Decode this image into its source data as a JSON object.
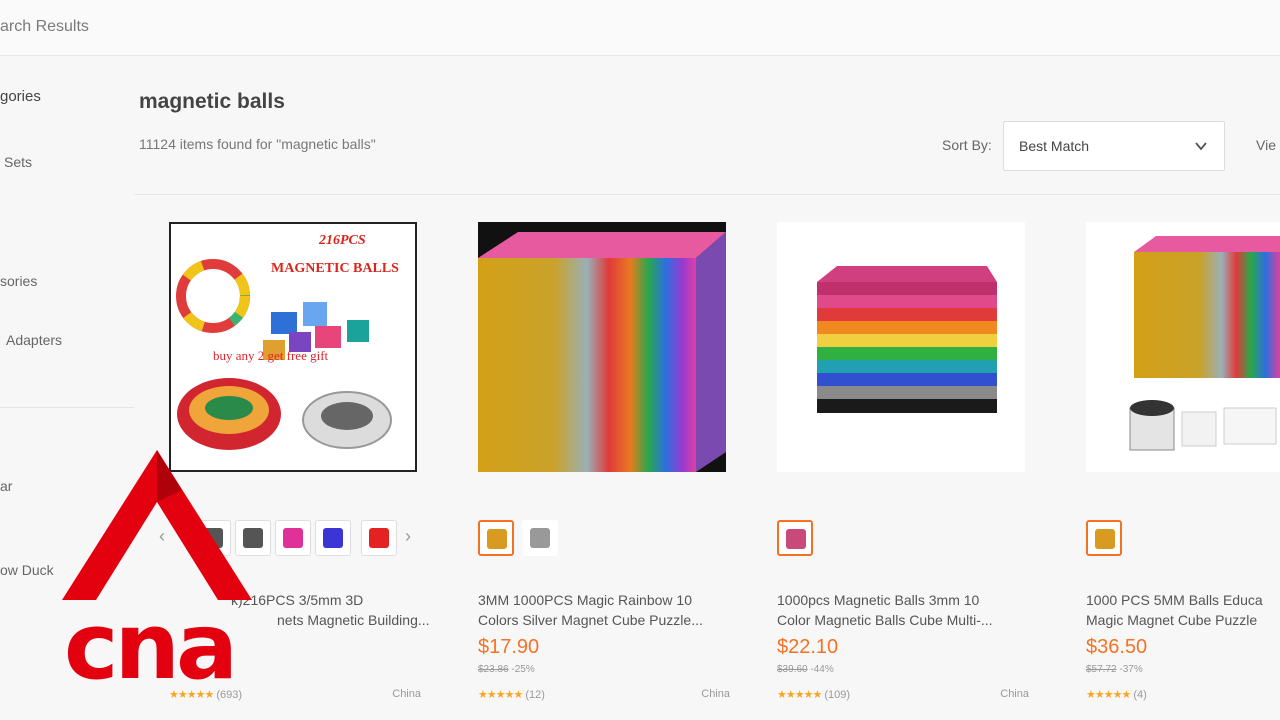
{
  "header": {
    "breadcrumb": "arch Results"
  },
  "sidebar": {
    "categories_heading": "gories",
    "items": [
      "Sets",
      "sories",
      "Adapters",
      "ar",
      "ow Duck"
    ]
  },
  "search": {
    "title": "magnetic balls",
    "count_text": "11124 items found for \"magnetic balls\""
  },
  "sort": {
    "label": "Sort By:",
    "value": "Best Match",
    "view_label": "Vie"
  },
  "products": [
    {
      "name_line1": "k)216PCS 3/5mm 3D",
      "name_line2": "nets Magnetic Building...",
      "price": "",
      "original_price": "",
      "discount": "",
      "rating_count": "(693)",
      "location": "China",
      "image_text_1": "216PCS",
      "image_text_2": "MAGNETIC BALLS",
      "image_text_3": "buy any 2 get free gift"
    },
    {
      "name_line1": "3MM 1000PCS Magic Rainbow 10",
      "name_line2": "Colors Silver Magnet Cube Puzzle...",
      "price": "$17.90",
      "original_price": "$23.86",
      "discount": "-25%",
      "rating_count": "(12)",
      "location": "China"
    },
    {
      "name_line1": "1000pcs Magnetic Balls 3mm 10",
      "name_line2": "Color Magnetic Balls Cube Multi-...",
      "price": "$22.10",
      "original_price": "$39.60",
      "discount": "-44%",
      "rating_count": "(109)",
      "location": "China"
    },
    {
      "name_line1": "1000 PCS 5MM Balls Educa",
      "name_line2": "Magic Magnet Cube Puzzle",
      "price": "$36.50",
      "original_price": "$57.72",
      "discount": "-37%",
      "rating_count": "(4)",
      "location": ""
    }
  ],
  "stars": "★★★★★",
  "logo_text": "cna",
  "colors": {
    "accent": "#f57224",
    "star": "#f5a623",
    "logo_red": "#e3000f"
  }
}
